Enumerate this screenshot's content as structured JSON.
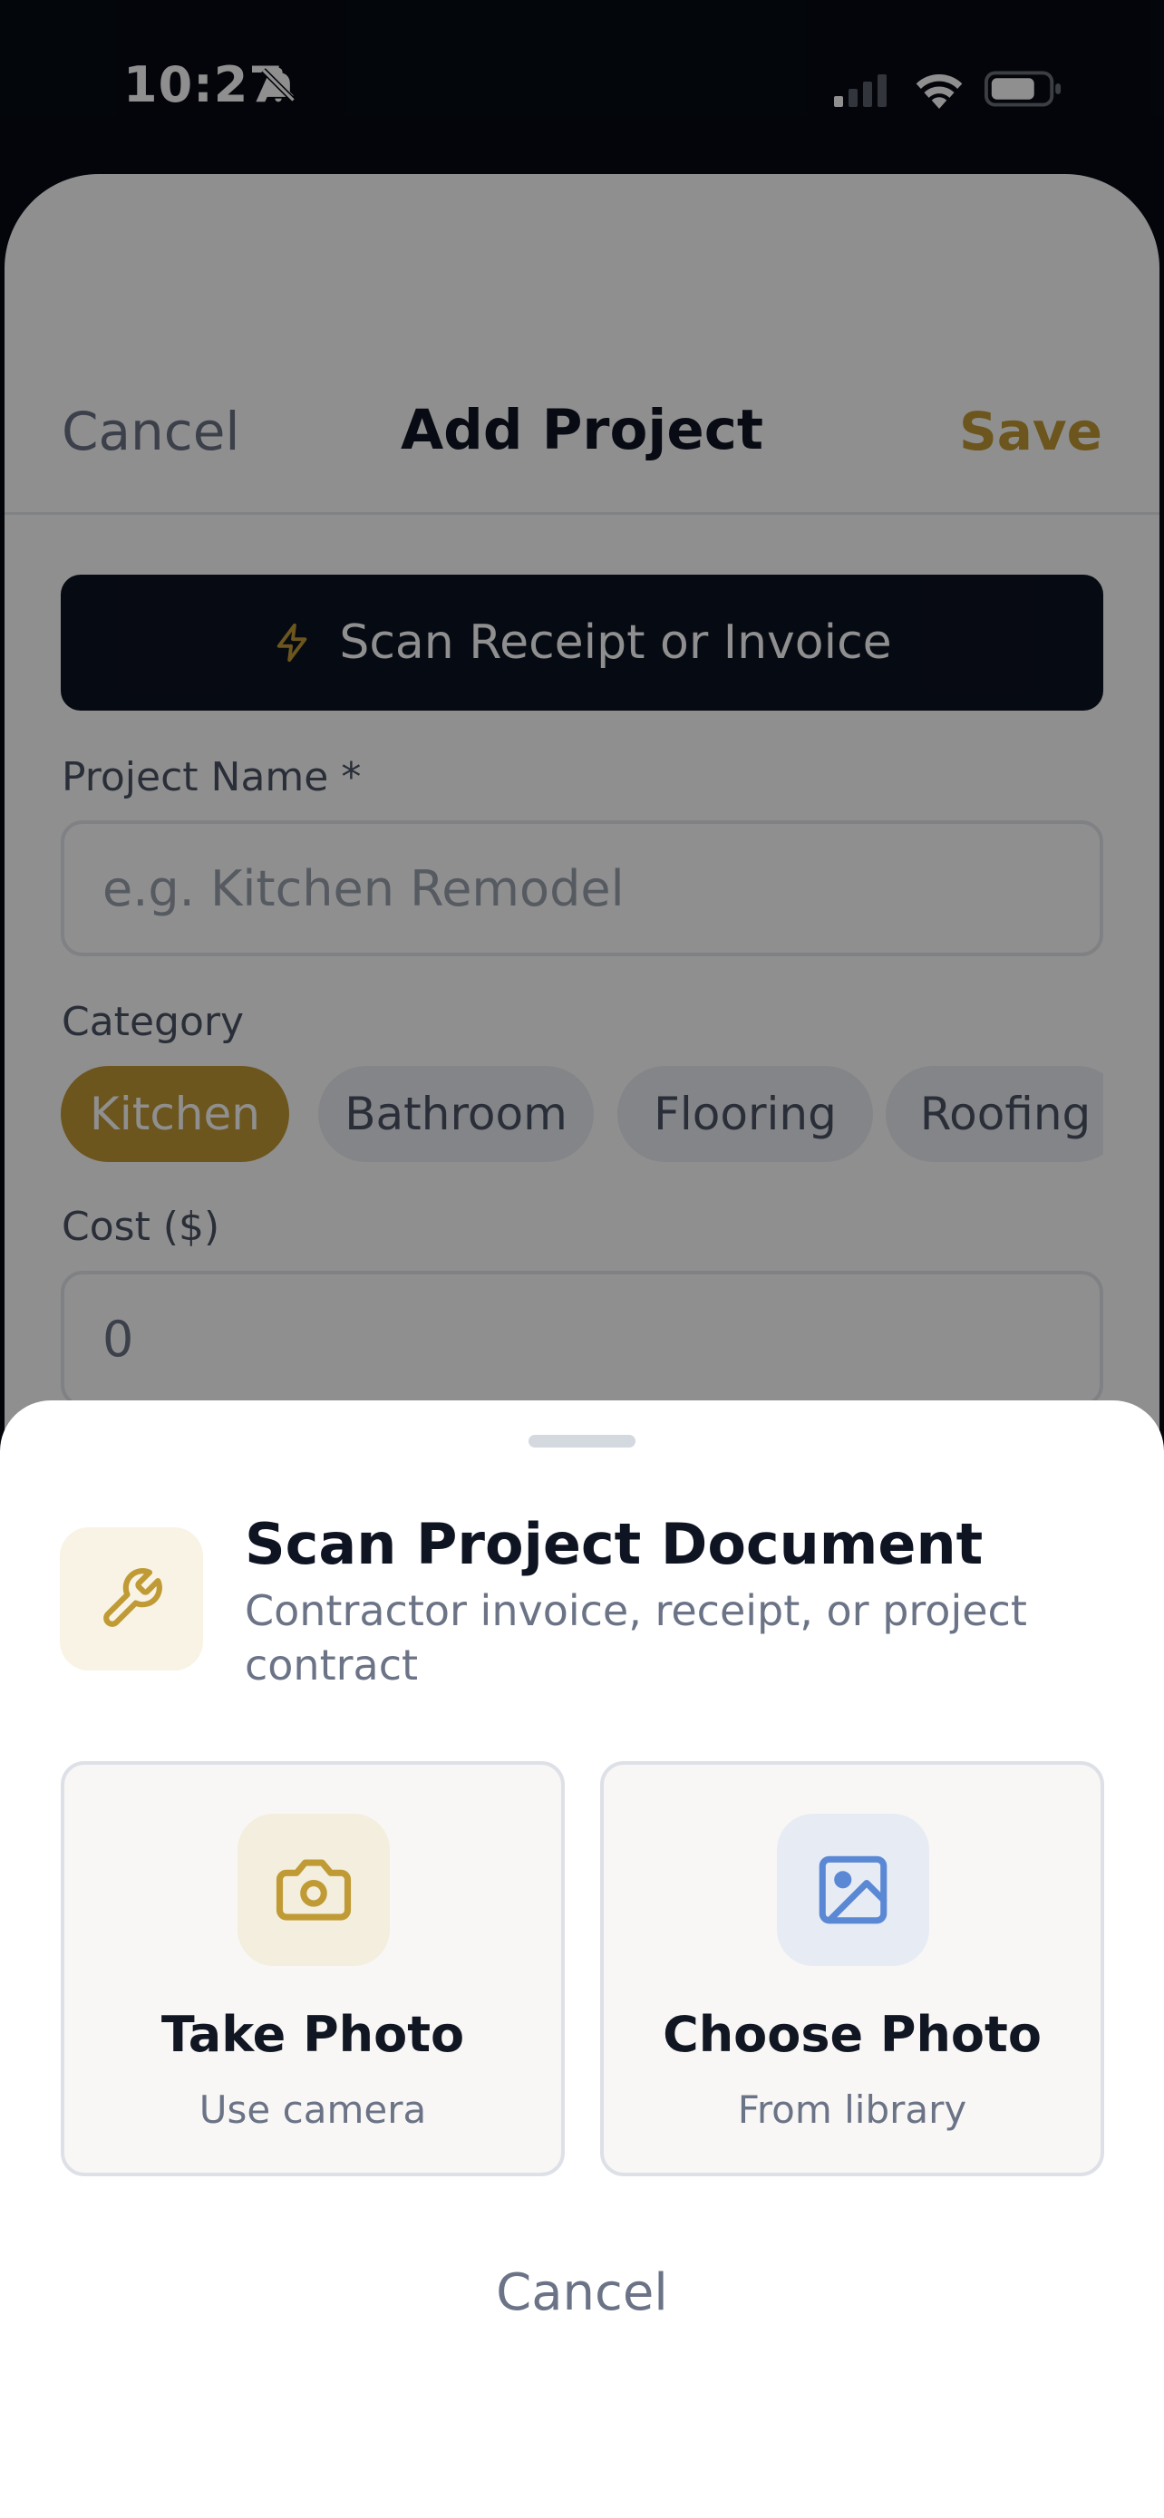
{
  "status_bar": {
    "time": "10:27"
  },
  "form": {
    "cancel_label": "Cancel",
    "title": "Add Project",
    "save_label": "Save",
    "scan_button_label": "Scan Receipt or Invoice",
    "project_name_label": "Project Name *",
    "project_name_placeholder": "e.g. Kitchen Remodel",
    "category_label": "Category",
    "categories": [
      {
        "label": "Kitchen",
        "selected": true
      },
      {
        "label": "Bathroom",
        "selected": false
      },
      {
        "label": "Flooring",
        "selected": false
      },
      {
        "label": "Roofing",
        "selected": false
      }
    ],
    "cost_label": "Cost ($)",
    "cost_value": "0"
  },
  "sheet": {
    "icon": "wrench-icon",
    "title": "Scan Project Document",
    "subtitle": "Contractor invoice, receipt, or project contract",
    "options": [
      {
        "title": "Take Photo",
        "subtitle": "Use camera",
        "icon": "camera-icon"
      },
      {
        "title": "Choose Photo",
        "subtitle": "From library",
        "icon": "image-icon"
      }
    ],
    "cancel_label": "Cancel"
  },
  "colors": {
    "accent": "#c09a35",
    "dark": "#0c1220",
    "image_icon": "#5b88d4"
  }
}
